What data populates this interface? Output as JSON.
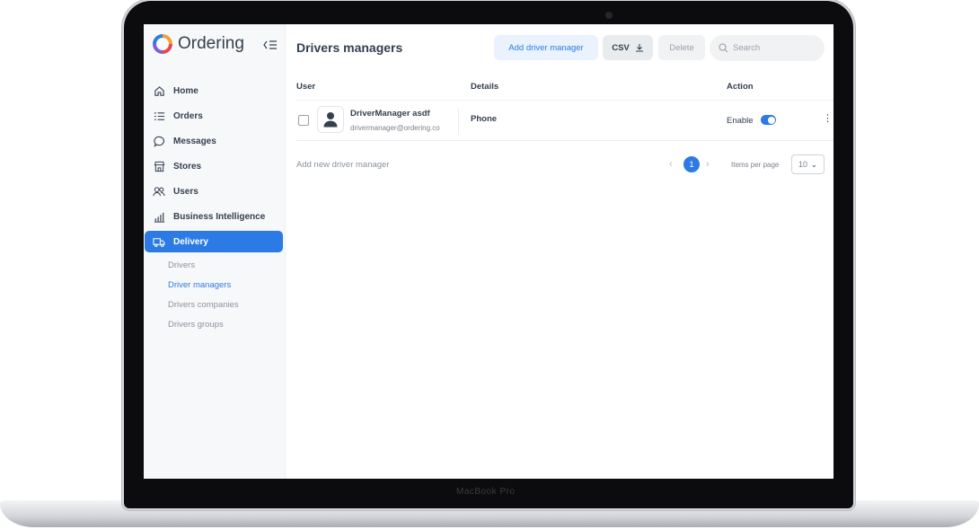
{
  "device": {
    "base_label": "MacBook Pro"
  },
  "app": {
    "logo_text": "Ordering"
  },
  "sidebar": {
    "items": [
      {
        "label": "Home",
        "icon": "home-icon"
      },
      {
        "label": "Orders",
        "icon": "list-icon"
      },
      {
        "label": "Messages",
        "icon": "chat-icon"
      },
      {
        "label": "Stores",
        "icon": "store-icon"
      },
      {
        "label": "Users",
        "icon": "users-icon"
      },
      {
        "label": "Business Intelligence",
        "icon": "bar-chart-icon"
      },
      {
        "label": "Delivery",
        "icon": "truck-icon",
        "active": true
      }
    ],
    "delivery_subitems": [
      {
        "label": "Drivers"
      },
      {
        "label": "Driver managers",
        "active": true
      },
      {
        "label": "Drivers companies"
      },
      {
        "label": "Drivers groups"
      }
    ]
  },
  "page": {
    "title": "Drivers managers",
    "add_button": "Add driver manager",
    "csv_button": "CSV",
    "delete_button": "Delete",
    "search_placeholder": "Search"
  },
  "table": {
    "columns": {
      "user": "User",
      "details": "Details",
      "action": "Action"
    },
    "rows": [
      {
        "name": "DriverManager asdf",
        "email": "drivermanager@ordering.co",
        "details": "Phone",
        "status_label": "Enable",
        "enabled": true
      }
    ]
  },
  "footer": {
    "add_link": "Add new driver manager",
    "current_page": "1",
    "items_per_page_label": "Items per page",
    "items_per_page_value": "10"
  },
  "colors": {
    "accent": "#2c7be5",
    "sidebar_bg": "#f7f8fa",
    "text": "#344050"
  }
}
